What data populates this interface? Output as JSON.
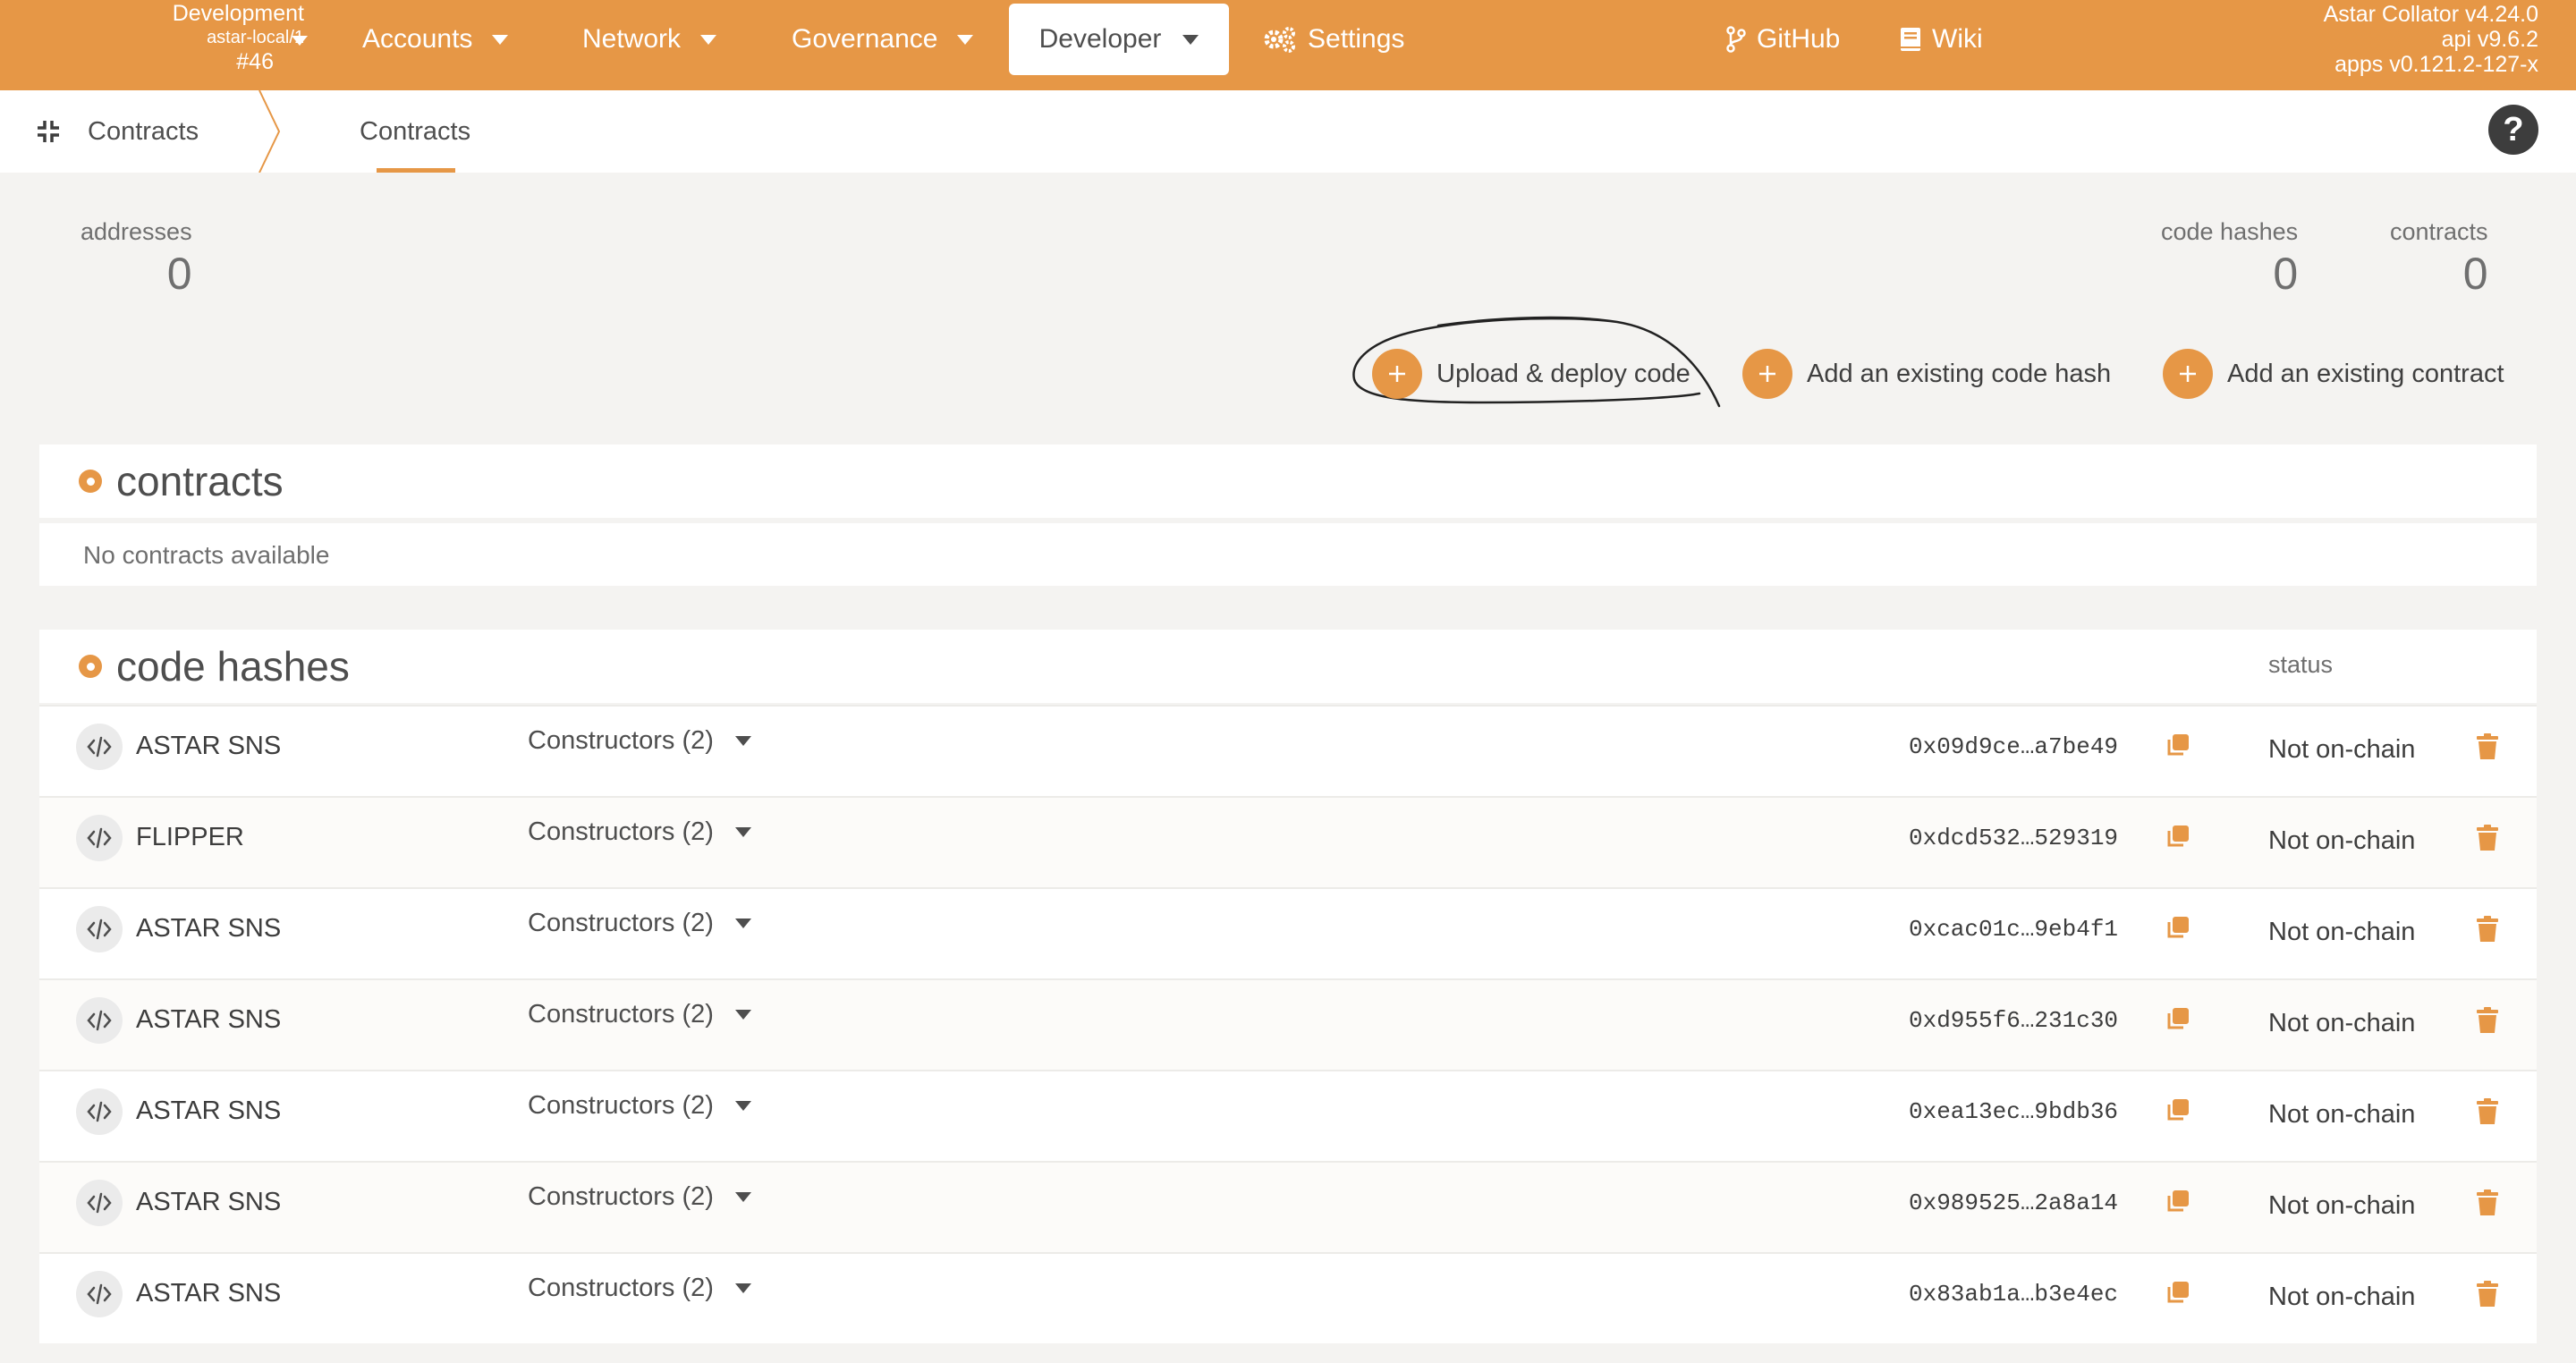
{
  "topbar": {
    "chain_name": "Development",
    "chain_endpoint": "astar-local/1",
    "block": "#46",
    "nav": [
      {
        "label": "Accounts"
      },
      {
        "label": "Network"
      },
      {
        "label": "Governance"
      },
      {
        "label": "Developer"
      },
      {
        "label": "Settings"
      },
      {
        "label": "GitHub"
      },
      {
        "label": "Wiki"
      }
    ],
    "version": {
      "node": "Astar Collator v4.24.0",
      "api": "api v9.6.2",
      "apps": "apps v0.121.2-127-x"
    },
    "bar_color": "#e69746"
  },
  "subheader": {
    "home_label": "Contracts",
    "tab_label": "Contracts",
    "help": "?"
  },
  "summary": {
    "addresses_label": "addresses",
    "addresses_value": "0",
    "code_hashes_label": "code hashes",
    "code_hashes_value": "0",
    "contracts_label": "contracts",
    "contracts_value": "0"
  },
  "actions": {
    "upload": "Upload & deploy code",
    "add_code_hash": "Add an existing code hash",
    "add_contract": "Add an existing contract"
  },
  "contracts_section": {
    "title": "contracts",
    "empty": "No contracts available"
  },
  "code_hashes_section": {
    "title": "code hashes",
    "status_header": "status",
    "rows": [
      {
        "name": "ASTAR SNS",
        "constructors": "Constructors (2)",
        "hash": "0x09d9ce…a7be49",
        "status": "Not on-chain"
      },
      {
        "name": "FLIPPER",
        "constructors": "Constructors (2)",
        "hash": "0xdcd532…529319",
        "status": "Not on-chain"
      },
      {
        "name": "ASTAR SNS",
        "constructors": "Constructors (2)",
        "hash": "0xcac01c…9eb4f1",
        "status": "Not on-chain"
      },
      {
        "name": "ASTAR SNS",
        "constructors": "Constructors (2)",
        "hash": "0xd955f6…231c30",
        "status": "Not on-chain"
      },
      {
        "name": "ASTAR SNS",
        "constructors": "Constructors (2)",
        "hash": "0xea13ec…9bdb36",
        "status": "Not on-chain"
      },
      {
        "name": "ASTAR SNS",
        "constructors": "Constructors (2)",
        "hash": "0x989525…2a8a14",
        "status": "Not on-chain"
      },
      {
        "name": "ASTAR SNS",
        "constructors": "Constructors (2)",
        "hash": "0x83ab1a…b3e4ec",
        "status": "Not on-chain"
      }
    ]
  },
  "icons": {
    "accent": "#e69746",
    "nav_caret": "caret-down-icon",
    "settings": "gears-icon",
    "github": "code-branch-icon",
    "wiki": "book-icon",
    "contracts_home": "compress-icon",
    "row_code": "code-icon",
    "row_copy": "copy-icon",
    "row_delete": "trash-icon"
  }
}
